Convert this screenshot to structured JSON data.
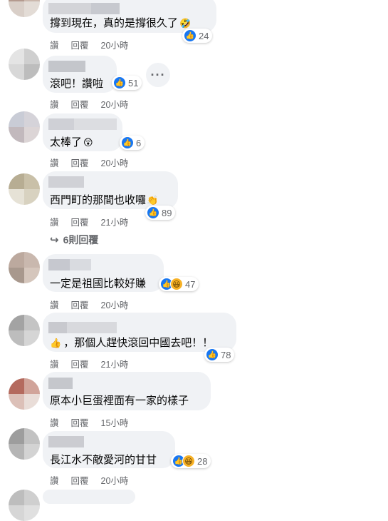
{
  "comments": [
    {
      "text": "撐到現在，真的是撐很久了",
      "count": "24",
      "time": "20小時",
      "emoji": "🤣"
    },
    {
      "text": "滾吧！讚啦",
      "count": "51",
      "time": "20小時"
    },
    {
      "text": "太棒了",
      "count": "6",
      "time": "20小時",
      "emoji": "😲"
    },
    {
      "text": "西門町的那間也收囉",
      "count": "89",
      "time": "21小時",
      "emoji": "👏"
    },
    {
      "text": "一定是祖國比較好賺",
      "count": "47",
      "time": "20小時"
    },
    {
      "text": "，那個人趕快滾回中國去吧！！",
      "count": "78",
      "time": "21小時",
      "lead_emoji": "👍"
    },
    {
      "text": "原本小巨蛋裡面有一家的樣子",
      "count": "",
      "time": "15小時"
    },
    {
      "text": "長江水不敵愛河的甘甘",
      "count": "28",
      "time": "20小時"
    }
  ],
  "labels": {
    "like": "讚",
    "reply": "回覆"
  },
  "replies_link": "6則回覆",
  "more_label": "···",
  "colors": {
    "like": "#1877f2",
    "haha": "#f7b125",
    "bubble": "#f0f2f5",
    "meta": "#65676b"
  }
}
